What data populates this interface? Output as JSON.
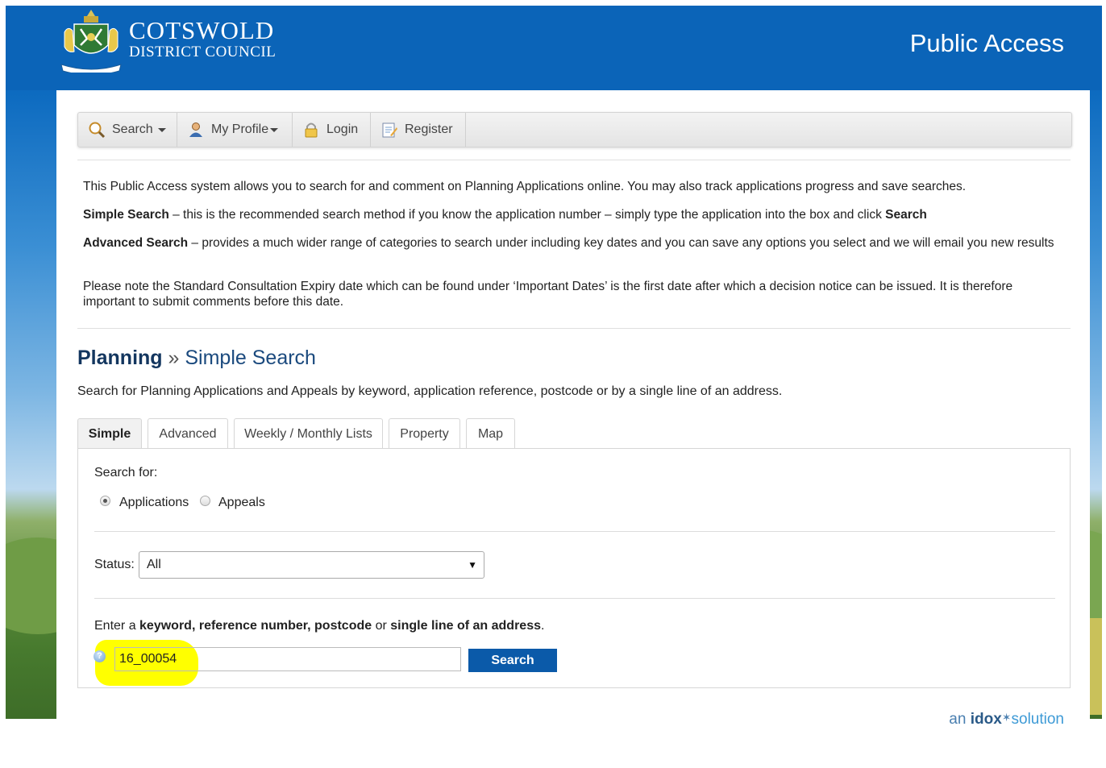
{
  "header": {
    "brand_line1": "COTSWOLD",
    "brand_line2": "DISTRICT COUNCIL",
    "site_title": "Public Access",
    "color": "#0b64b8"
  },
  "nav": {
    "items": [
      {
        "label": "Search",
        "icon": "magnifier-icon",
        "dropdown": true
      },
      {
        "label": "My Profile",
        "icon": "user-icon",
        "dropdown": true
      },
      {
        "label": "Login",
        "icon": "padlock-icon",
        "dropdown": false
      },
      {
        "label": "Register",
        "icon": "register-form-icon",
        "dropdown": false
      }
    ]
  },
  "intro": {
    "p1": "This Public Access system allows you to search for and comment on Planning Applications online. You may also track applications progress and save searches.",
    "p2_bold": "Simple Search",
    "p2_text": " – this is the recommended search method if you know the application number – simply type the application into the box and click ",
    "p2_bold2": "Search",
    "p3_bold": "Advanced Search",
    "p3_text": " – provides a much wider range of categories to search under including key dates and you can save any options you select and we will email you new results",
    "p4": "Please note the Standard Consultation Expiry  date which can be found under ‘Important Dates’ is the first date after which a decision notice can be issued. It is therefore important to submit comments before this date."
  },
  "page": {
    "heading_main": "Planning",
    "heading_sep": "»",
    "heading_sub": "Simple Search",
    "description": "Search for Planning Applications and Appeals by keyword, application reference, postcode or by a single line of an address."
  },
  "tabs": [
    "Simple",
    "Advanced",
    "Weekly / Monthly Lists",
    "Property",
    "Map"
  ],
  "form": {
    "search_for_label": "Search for:",
    "radio_applications": "Applications",
    "radio_appeals": "Appeals",
    "selected_type": "Applications",
    "status_label": "Status:",
    "status_value": "All",
    "kw_prefix": "Enter a ",
    "kw_b1": "keyword",
    "kw_c1": ", ",
    "kw_b2": "reference number",
    "kw_c2": ", ",
    "kw_b3": "postcode",
    "kw_or": " or ",
    "kw_b4": "single line of an address",
    "kw_end": ".",
    "search_value": "16_00054",
    "search_button": "Search",
    "highlight_color": "#ffff00"
  },
  "footer": {
    "an": "an ",
    "idox": "idox",
    "solution": "solution"
  }
}
